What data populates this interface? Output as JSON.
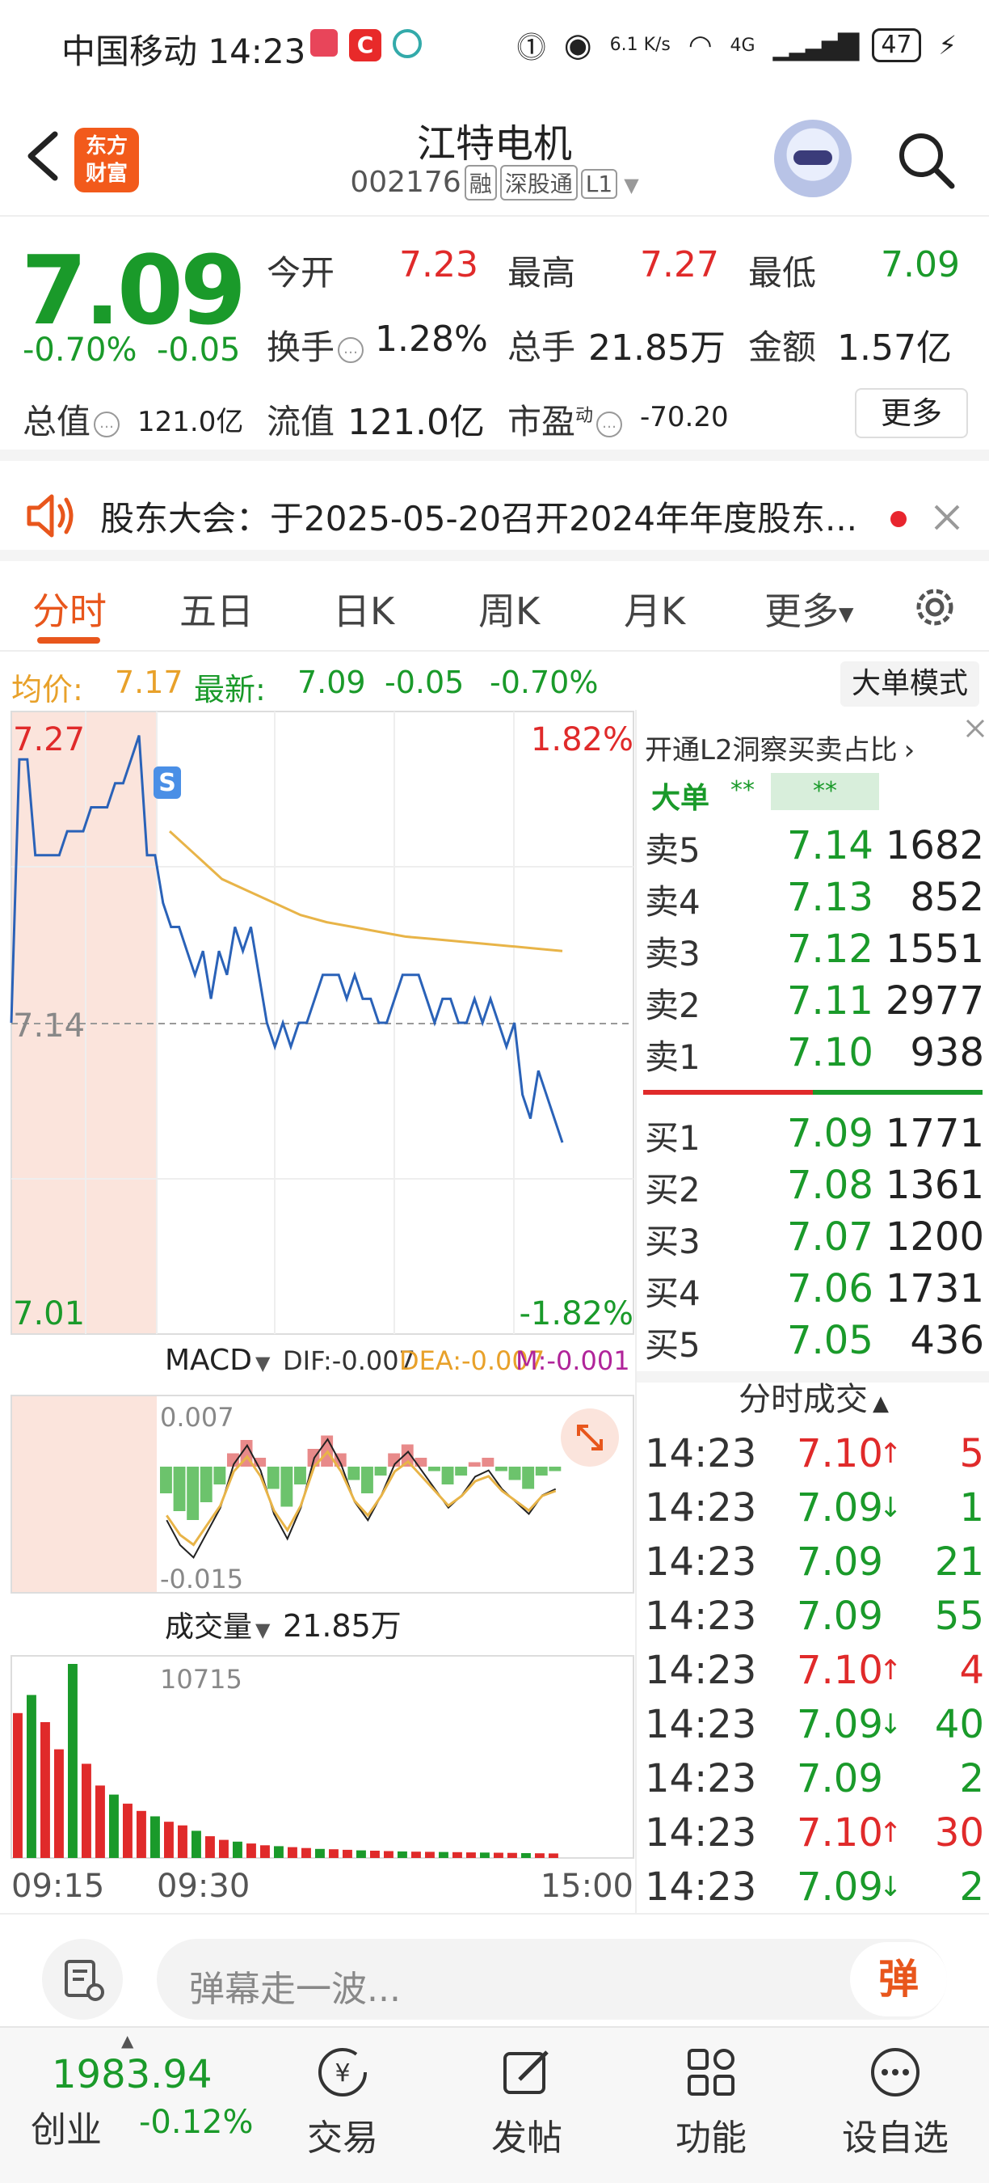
{
  "status_bar": {
    "carrier_time": "中国移动 14:23",
    "net_speed": "6.1 K/s",
    "signal": "4G",
    "battery": "47"
  },
  "header": {
    "logo_text": "东方 财富",
    "stock_name": "江特电机",
    "stock_code": "002176",
    "tags": [
      "融",
      "深股通",
      "L1"
    ]
  },
  "quote": {
    "price": "7.09",
    "change_pct": "-0.70%",
    "change": "-0.05",
    "open_label": "今开",
    "open": "7.23",
    "high_label": "最高",
    "high": "7.27",
    "low_label": "最低",
    "low": "7.09",
    "turnover_label": "换手",
    "turnover": "1.28%",
    "volume_label": "总手",
    "volume": "21.85万",
    "amount_label": "金额",
    "amount": "1.57亿",
    "mktcap_label": "总值",
    "mktcap": "121.0亿",
    "float_label": "流值",
    "float": "121.0亿",
    "pe_label": "市盈",
    "pe_sup": "动",
    "pe": "-70.20",
    "more_label": "更多"
  },
  "notice": {
    "text": "股东大会：于2025-05-20召开2024年年度股东..."
  },
  "tabs": [
    "分时",
    "五日",
    "日K",
    "周K",
    "月K",
    "更多"
  ],
  "info_line": {
    "avg_label": "均价:",
    "avg": "7.17",
    "latest_label": "最新:",
    "latest": "7.09",
    "change": "-0.05",
    "change_pct": "-0.70%",
    "big_mode": "大单模式"
  },
  "chart_labels": {
    "top_price": "7.27",
    "top_pct": "1.82%",
    "mid_price": "7.14",
    "bottom_price": "7.01",
    "bottom_pct": "-1.82%",
    "s_marker": "S",
    "macd_title": "MACD",
    "dif": "DIF:-0.007",
    "dea": "DEA:-0.007",
    "m": "M:-0.001",
    "macd_top": "0.007",
    "macd_bottom": "-0.015",
    "vol_title": "成交量",
    "vol_value": "21.85万",
    "vol_max": "10715",
    "time_start": "09:15",
    "time_open": "09:30",
    "time_end": "15:00"
  },
  "chart_data": [
    {
      "type": "line",
      "title": "",
      "ylim": [
        7.01,
        7.27
      ],
      "prev_close": 7.14,
      "series": [
        {
          "values": [
            7.14,
            7.25,
            7.25,
            7.21,
            7.21,
            7.21,
            7.21,
            7.22,
            7.22,
            7.22,
            7.23,
            7.23,
            7.23,
            7.24,
            7.24,
            7.25,
            7.26,
            7.21,
            7.21,
            7.19,
            7.18,
            7.18,
            7.17,
            7.16,
            7.17,
            7.15,
            7.17,
            7.16,
            7.18,
            7.17,
            7.18,
            7.16,
            7.14,
            7.13,
            7.14,
            7.13,
            7.14,
            7.14,
            7.15,
            7.16,
            7.16,
            7.16,
            7.15,
            7.16,
            7.15,
            7.15,
            7.14,
            7.14,
            7.15,
            7.16,
            7.16,
            7.16,
            7.15,
            7.14,
            7.15,
            7.15,
            7.14,
            7.14,
            7.15,
            7.14,
            7.15,
            7.14,
            7.13,
            7.14,
            7.11,
            7.1,
            7.12,
            7.11,
            7.1,
            7.09
          ]
        },
        {
          "values": [
            7.22,
            7.21,
            7.2,
            7.195,
            7.19,
            7.185,
            7.182,
            7.18,
            7.178,
            7.176,
            7.175,
            7.174,
            7.173,
            7.172,
            7.171,
            7.17
          ]
        }
      ]
    },
    {
      "type": "bar",
      "title": "MACD",
      "values": [
        -0.006,
        -0.01,
        -0.012,
        -0.008,
        -0.004,
        0.003,
        0.006,
        0.002,
        -0.005,
        -0.009,
        -0.004,
        0.004,
        0.007,
        0.003,
        -0.003,
        -0.006,
        -0.002,
        0.003,
        0.005,
        0.002,
        -0.001,
        -0.004,
        -0.002,
        0.001,
        0.002,
        -0.001,
        -0.003,
        -0.005,
        -0.002,
        -0.001
      ]
    },
    {
      "type": "bar",
      "title": "成交量",
      "ylim": [
        0,
        10715
      ],
      "values": [
        8000,
        9000,
        7500,
        6000,
        10715,
        5200,
        4000,
        3500,
        3000,
        2600,
        2300,
        2000,
        1800,
        1500,
        1200,
        1000,
        900,
        800,
        700,
        650,
        600,
        550,
        500,
        480,
        450,
        420,
        400,
        380,
        360,
        350,
        340,
        330,
        320,
        310,
        300,
        290,
        280,
        270,
        260,
        250
      ]
    }
  ],
  "order_book": {
    "l2_hint": "开通L2洞察买卖占比",
    "big_label": "大单",
    "big_val1": "**",
    "big_val2": "**",
    "sells": [
      {
        "label": "卖5",
        "price": "7.14",
        "vol": "1682"
      },
      {
        "label": "卖4",
        "price": "7.13",
        "vol": "852"
      },
      {
        "label": "卖3",
        "price": "7.12",
        "vol": "1551"
      },
      {
        "label": "卖2",
        "price": "7.11",
        "vol": "2977"
      },
      {
        "label": "卖1",
        "price": "7.10",
        "vol": "938"
      }
    ],
    "buys": [
      {
        "label": "买1",
        "price": "7.09",
        "vol": "1771"
      },
      {
        "label": "买2",
        "price": "7.08",
        "vol": "1361"
      },
      {
        "label": "买3",
        "price": "7.07",
        "vol": "1200"
      },
      {
        "label": "买4",
        "price": "7.06",
        "vol": "1731"
      },
      {
        "label": "买5",
        "price": "7.05",
        "vol": "436"
      }
    ]
  },
  "trades": {
    "title": "分时成交",
    "rows": [
      {
        "time": "14:23",
        "price": "7.10",
        "dir": "up",
        "vol": "5",
        "color": "#e02a2a"
      },
      {
        "time": "14:23",
        "price": "7.09",
        "dir": "down",
        "vol": "1",
        "color": "#1a9a2a"
      },
      {
        "time": "14:23",
        "price": "7.09",
        "dir": "",
        "vol": "21",
        "color": "#1a9a2a"
      },
      {
        "time": "14:23",
        "price": "7.09",
        "dir": "",
        "vol": "55",
        "color": "#1a9a2a"
      },
      {
        "time": "14:23",
        "price": "7.10",
        "dir": "up",
        "vol": "4",
        "color": "#e02a2a"
      },
      {
        "time": "14:23",
        "price": "7.09",
        "dir": "down",
        "vol": "40",
        "color": "#1a9a2a"
      },
      {
        "time": "14:23",
        "price": "7.09",
        "dir": "",
        "vol": "2",
        "color": "#1a9a2a"
      },
      {
        "time": "14:23",
        "price": "7.10",
        "dir": "up",
        "vol": "30",
        "color": "#e02a2a"
      },
      {
        "time": "14:23",
        "price": "7.09",
        "dir": "down",
        "vol": "2",
        "color": "#1a9a2a"
      }
    ]
  },
  "comment": {
    "placeholder": "弹幕走一波...",
    "danmu_label": "弹"
  },
  "bottom_nav": {
    "index_value": "1983.94",
    "index_name": "创业",
    "index_change": "-0.12%",
    "items": [
      "交易",
      "发帖",
      "功能",
      "设自选"
    ]
  },
  "colors": {
    "up": "#e02a2a",
    "down": "#1a9a2a",
    "accent": "#e8561c",
    "price_line": "#2a62b8",
    "avg_line": "#e8b448"
  }
}
